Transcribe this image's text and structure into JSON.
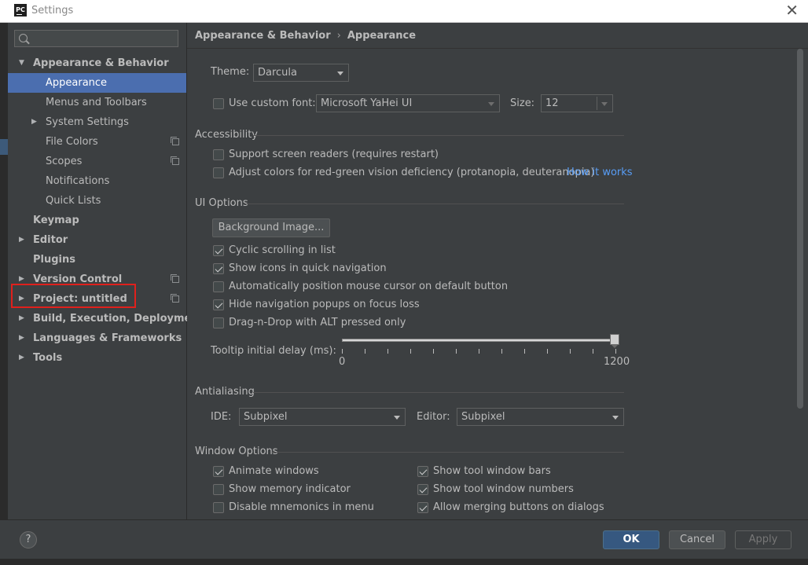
{
  "window": {
    "title": "Settings",
    "app_icon_text": "PC"
  },
  "sidebar": {
    "search_placeholder": "",
    "items": [
      {
        "label": "Appearance & Behavior",
        "bold": true,
        "arrow": "down"
      },
      {
        "label": "Appearance",
        "selected": true
      },
      {
        "label": "Menus and Toolbars"
      },
      {
        "label": "System Settings",
        "arrow": "right"
      },
      {
        "label": "File Colors",
        "copy_icon": true
      },
      {
        "label": "Scopes",
        "copy_icon": true
      },
      {
        "label": "Notifications"
      },
      {
        "label": "Quick Lists"
      },
      {
        "label": "Keymap",
        "bold": true
      },
      {
        "label": "Editor",
        "bold": true,
        "arrow": "right"
      },
      {
        "label": "Plugins",
        "bold": true
      },
      {
        "label": "Version Control",
        "bold": true,
        "arrow": "right",
        "copy_icon": true
      },
      {
        "label": "Project: untitled",
        "bold": true,
        "arrow": "right",
        "copy_icon": true,
        "highlighted": true
      },
      {
        "label": "Build, Execution, Deployment",
        "bold": true,
        "arrow": "right"
      },
      {
        "label": "Languages & Frameworks",
        "bold": true,
        "arrow": "right"
      },
      {
        "label": "Tools",
        "bold": true,
        "arrow": "right"
      }
    ]
  },
  "breadcrumb": {
    "parent": "Appearance & Behavior",
    "separator": "›",
    "current": "Appearance"
  },
  "theme": {
    "label": "Theme:",
    "value": "Darcula"
  },
  "font": {
    "checkbox_label": "Use custom font:",
    "checked": false,
    "font_value": "Microsoft YaHei UI",
    "size_label": "Size:",
    "size_value": "12"
  },
  "accessibility": {
    "title": "Accessibility",
    "screen_readers": {
      "label": "Support screen readers (requires restart)",
      "checked": false
    },
    "color_deficiency": {
      "label": "Adjust colors for red-green vision deficiency (protanopia, deuteranopia)",
      "checked": false,
      "link": "How it works"
    }
  },
  "ui_options": {
    "title": "UI Options",
    "bg_image_button": "Background Image...",
    "checkboxes": [
      {
        "label": "Cyclic scrolling in list",
        "checked": true
      },
      {
        "label": "Show icons in quick navigation",
        "checked": true
      },
      {
        "label": "Automatically position mouse cursor on default button",
        "checked": false
      },
      {
        "label": "Hide navigation popups on focus loss",
        "checked": true
      },
      {
        "label": "Drag-n-Drop with ALT pressed only",
        "checked": false
      }
    ],
    "tooltip": {
      "label": "Tooltip initial delay (ms):",
      "min": "0",
      "max": "1200",
      "value": 1200
    }
  },
  "antialiasing": {
    "title": "Antialiasing",
    "ide_label": "IDE:",
    "ide_value": "Subpixel",
    "editor_label": "Editor:",
    "editor_value": "Subpixel"
  },
  "window_options": {
    "title": "Window Options",
    "left": [
      {
        "label": "Animate windows",
        "checked": true
      },
      {
        "label": "Show memory indicator",
        "checked": false
      },
      {
        "label": "Disable mnemonics in menu",
        "checked": false
      }
    ],
    "right": [
      {
        "label": "Show tool window bars",
        "checked": true
      },
      {
        "label": "Show tool window numbers",
        "checked": true
      },
      {
        "label": "Allow merging buttons on dialogs",
        "checked": true
      }
    ]
  },
  "footer": {
    "help": "?",
    "ok": "OK",
    "cancel": "Cancel",
    "apply": "Apply"
  }
}
